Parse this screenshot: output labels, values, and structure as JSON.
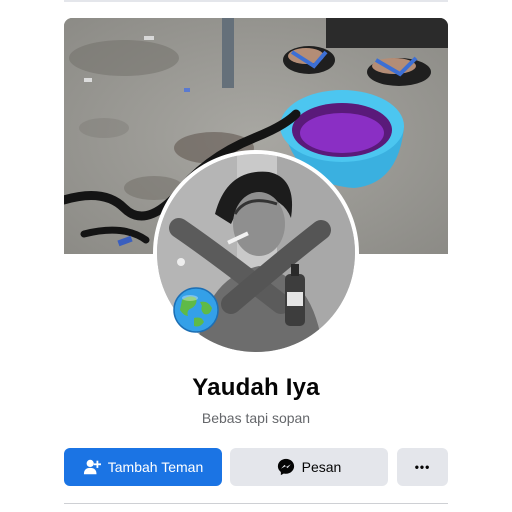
{
  "profile": {
    "name": "Yaudah Iya",
    "bio": "Bebas tapi sopan",
    "cover_description": "concrete floor with sandals, blue basin with purple liquid, black snake",
    "avatar_description": "grayscale portrait, arms crossed, cigarette",
    "badge": "globe-icon"
  },
  "actions": {
    "add_friend_label": "Tambah Teman",
    "message_label": "Pesan",
    "more_label": "•••"
  },
  "colors": {
    "primary": "#1b74e4",
    "secondary_bg": "#e4e6eb",
    "text_primary": "#050505",
    "text_secondary": "#65676b"
  },
  "icons": {
    "add_friend": "add-friend-icon",
    "message": "messenger-icon",
    "more": "more-dots-icon"
  }
}
